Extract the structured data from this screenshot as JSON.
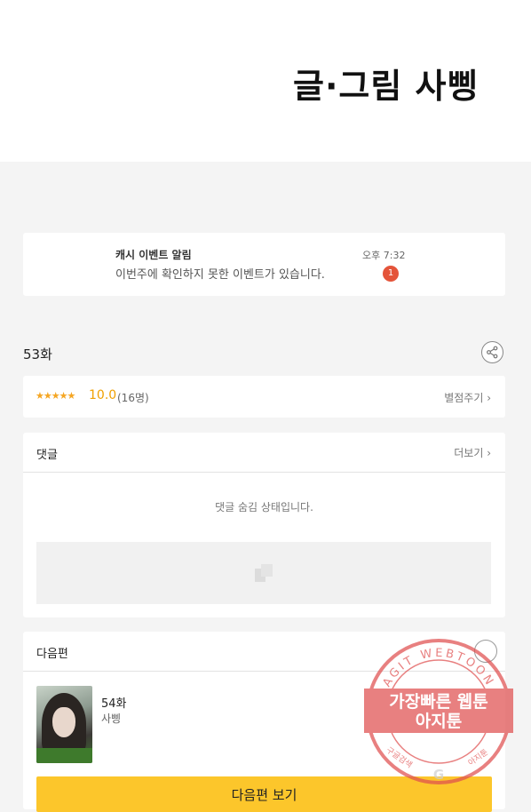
{
  "header": {
    "credit": "글·그림  사삥"
  },
  "notification": {
    "title": "캐시 이벤트 알림",
    "message": "이번주에 확인하지 못한 이벤트가 있습니다.",
    "time": "오후 7:32",
    "badge": "1"
  },
  "episode": {
    "title": "53화"
  },
  "rating": {
    "stars": "★★★★★",
    "score": "10.0",
    "count": "(16명)",
    "rate_label": "별점주기 ›"
  },
  "comments": {
    "title": "댓글",
    "more_label": "더보기 ›",
    "hidden_message": "댓글 숨김 상태입니다."
  },
  "next_episode": {
    "title": "다음편",
    "episode": "54화",
    "author": "사삥",
    "button_label": "다음편 보기"
  },
  "watermark": {
    "ring_text": "AGIT WEBTOON",
    "line1": "가장빠른 웹툰",
    "line2": "아지툰",
    "bottom_left": "구글검색",
    "bottom_right": "아지툰",
    "letter": "G"
  },
  "colors": {
    "accent_button": "#fcc62b",
    "badge": "#e4543a",
    "rating": "#f0a000",
    "stamp": "#e05050"
  }
}
